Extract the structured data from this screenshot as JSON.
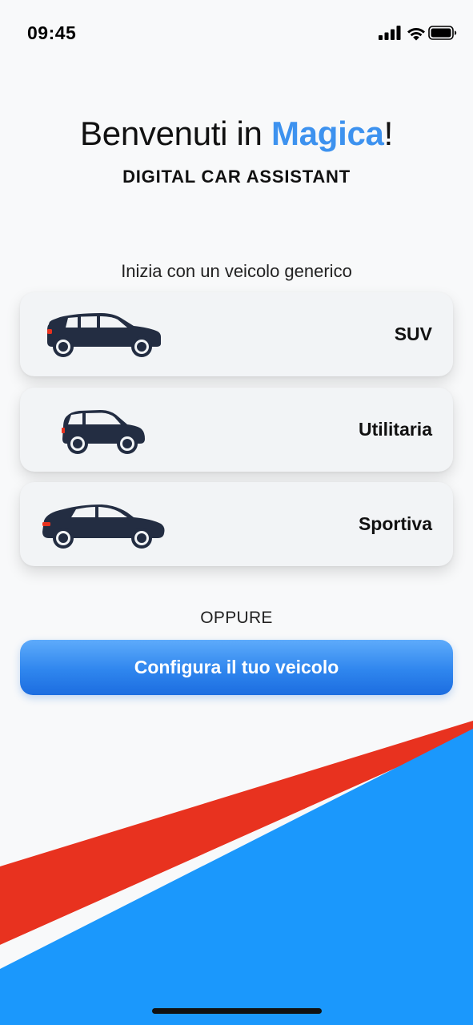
{
  "status_bar": {
    "time": "09:45",
    "icons": [
      "signal-icon",
      "wifi-icon",
      "battery-icon"
    ]
  },
  "header": {
    "welcome_prefix": "Benvenuti in ",
    "brand_name": "Magica",
    "welcome_suffix": "!",
    "subtitle": "DIGITAL CAR ASSISTANT"
  },
  "generic_section": {
    "label": "Inizia con un veicolo generico",
    "vehicles": [
      {
        "label": "SUV",
        "icon": "suv-car-icon"
      },
      {
        "label": "Utilitaria",
        "icon": "city-car-icon"
      },
      {
        "label": "Sportiva",
        "icon": "sport-car-icon"
      }
    ]
  },
  "or_label": "OPPURE",
  "configure_button": {
    "label": "Configura il tuo veicolo"
  },
  "colors": {
    "brand": "#3d92ef",
    "button": "#2f86ee",
    "stripe_red": "#e8321f",
    "stripe_blue": "#1b98fc",
    "car": "#232d42"
  }
}
